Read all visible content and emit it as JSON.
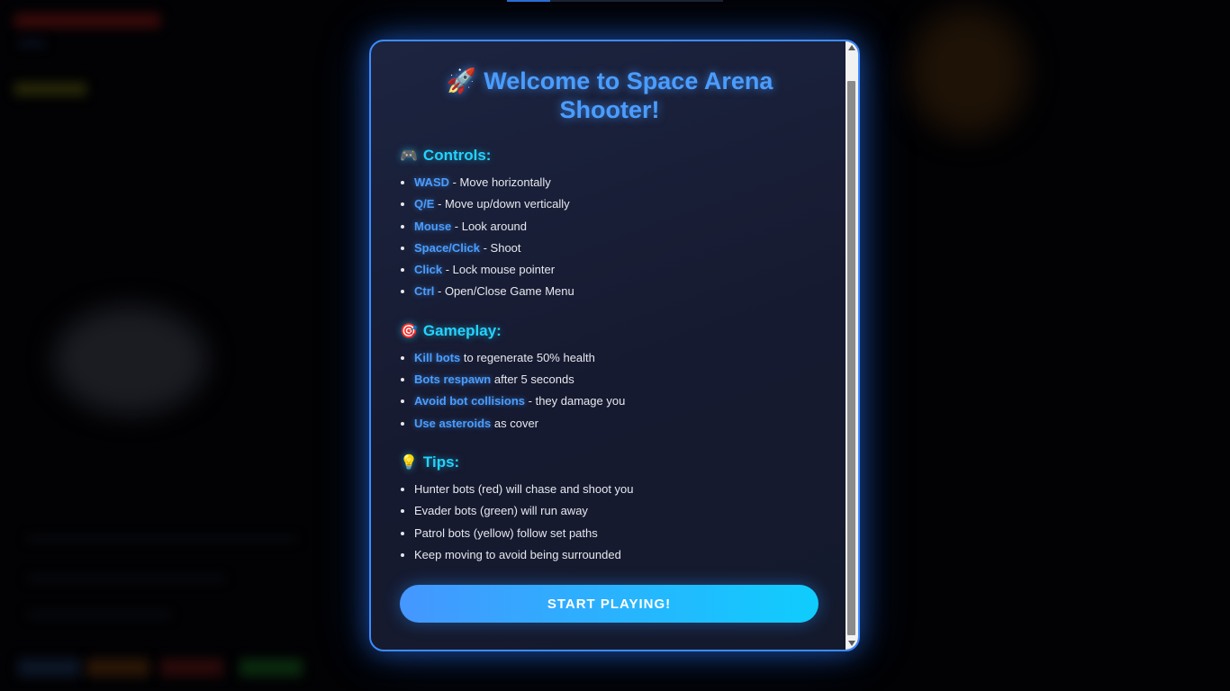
{
  "modal": {
    "title_emoji": "🚀",
    "title": "Welcome to Space Arena Shooter!",
    "sections": [
      {
        "emoji": "🎮",
        "title": "Controls:",
        "items": [
          {
            "key": "WASD",
            "text": " - Move horizontally"
          },
          {
            "key": "Q/E",
            "text": " - Move up/down vertically"
          },
          {
            "key": "Mouse",
            "text": " - Look around"
          },
          {
            "key": "Space/Click",
            "text": " - Shoot"
          },
          {
            "key": "Click",
            "text": " - Lock mouse pointer"
          },
          {
            "key": "Ctrl",
            "text": " - Open/Close Game Menu"
          }
        ]
      },
      {
        "emoji": "🎯",
        "title": "Gameplay:",
        "items": [
          {
            "key": "Kill bots",
            "text": " to regenerate 50% health"
          },
          {
            "key": "Bots respawn",
            "text": " after 5 seconds"
          },
          {
            "key": "Avoid bot collisions",
            "text": " - they damage you"
          },
          {
            "key": "Use asteroids",
            "text": " as cover"
          }
        ]
      },
      {
        "emoji": "💡",
        "title": "Tips:",
        "items": [
          {
            "key": "",
            "text": "Hunter bots (red) will chase and shoot you"
          },
          {
            "key": "",
            "text": "Evader bots (green) will run away"
          },
          {
            "key": "",
            "text": "Patrol bots (yellow) follow set paths"
          },
          {
            "key": "",
            "text": "Keep moving to avoid being surrounded"
          }
        ]
      }
    ],
    "start_button_label": "START PLAYING!"
  },
  "colors": {
    "accent": "#4a9dff",
    "section_title": "#22d3ff",
    "modal_border": "#3d8bff",
    "button_gradient_start": "#4597ff",
    "button_gradient_end": "#0fcdfd"
  }
}
